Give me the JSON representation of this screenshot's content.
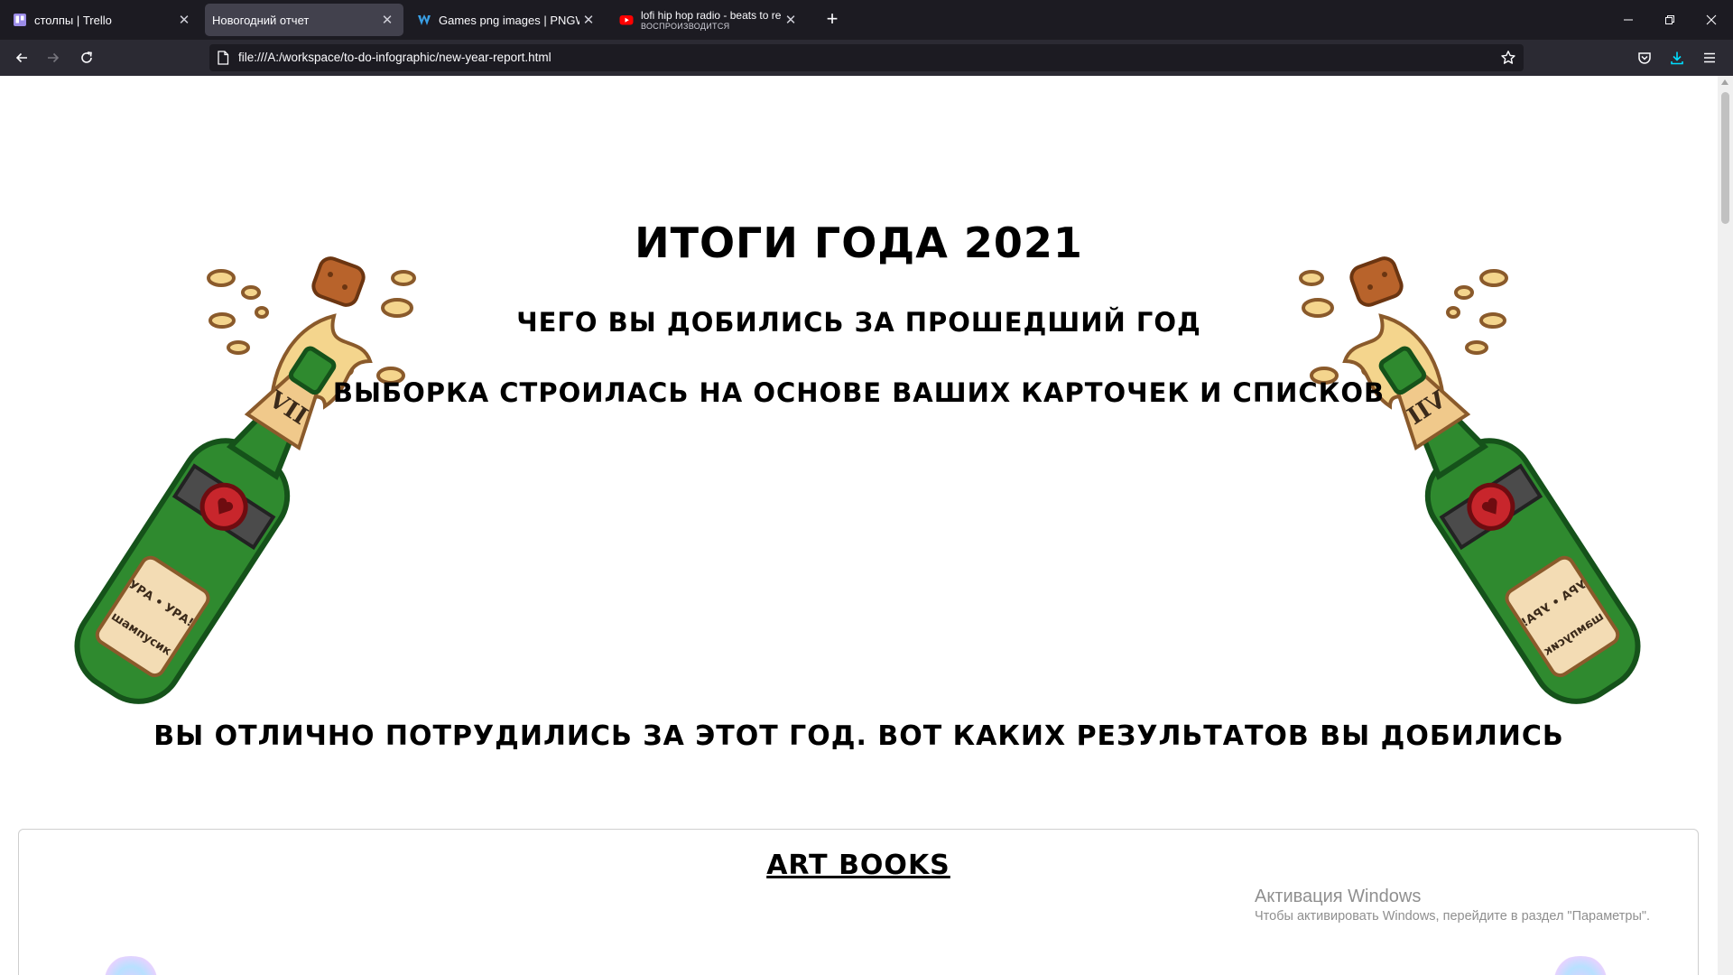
{
  "browser": {
    "tabs": [
      {
        "title": "столпы | Trello",
        "icon": "trello-icon",
        "active": false
      },
      {
        "title": "Новогодний отчет",
        "icon": "none",
        "active": true
      },
      {
        "title": "Games png images | PNGWing",
        "icon": "pngwing-icon",
        "active": false
      },
      {
        "title": "lofi hip hop radio - beats to rela",
        "subtitle": "ВОСПРОИЗВОДИТСЯ",
        "icon": "youtube-icon",
        "active": false
      }
    ],
    "url": "file:///A:/workspace/to-do-infographic/new-year-report.html",
    "colors": {
      "tabbar": "#1c1b22",
      "navbar": "#2b2a33",
      "active_tab": "#42414d",
      "download_accent": "#0df"
    }
  },
  "page": {
    "title": "Итоги года 2021",
    "subtitle1": "Чего вы добились за прошедший год",
    "subtitle2": "Выборка строилась на основе ваших карточек и списков",
    "results_heading": "Вы отлично потрудились за этот год. Вот каких результатов вы добились",
    "card": {
      "title": "ART BOOKS"
    },
    "bottle_label": {
      "line1": "УРА • УРА!",
      "line2": "шампусик",
      "roman": "VII"
    }
  },
  "watermark": {
    "title": "Активация Windows",
    "subtitle": "Чтобы активировать Windows, перейдите в раздел \"Параметры\"."
  }
}
